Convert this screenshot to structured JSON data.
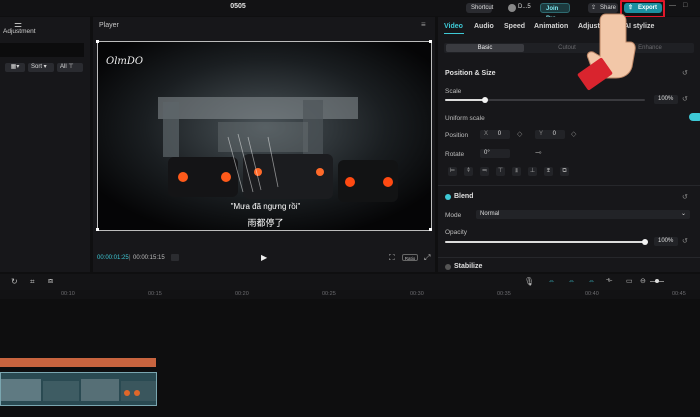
{
  "app": {
    "project_title": "0505"
  },
  "titlebar": {
    "shortcut_label": "Shortcut",
    "user_label": "D...5",
    "join_pro_label": "Join Pro",
    "share_label": "Share",
    "export_label": "Export"
  },
  "left_panel": {
    "adjustment_label": "Adjustment",
    "sort_label": "Sort",
    "all_label": "All"
  },
  "player": {
    "title": "Player",
    "watermark": "OlmDO",
    "subtitle_vi": "\"Mưa đã ngưng rồi\"",
    "subtitle_cn": "雨都停了",
    "time_current": "00:00:01:25",
    "time_total": "00:00:15:15",
    "ratio_label": "Ratio"
  },
  "inspector": {
    "tabs": [
      "Video",
      "Audio",
      "Speed",
      "Animation",
      "Adjustment",
      "AI stylize"
    ],
    "subtabs": [
      "Basic",
      "Cutout",
      "Enhance"
    ],
    "position_size": {
      "title": "Position & Size",
      "scale_label": "Scale",
      "scale_value": "100%",
      "scale_fraction": 0.2,
      "uniform_scale_label": "Uniform scale",
      "position_label": "Position",
      "x_label": "X",
      "x_value": "0",
      "y_label": "Y",
      "y_value": "0",
      "rotate_label": "Rotate",
      "rotate_value": "0°"
    },
    "blend": {
      "title": "Blend",
      "mode_label": "Mode",
      "mode_value": "Normal",
      "opacity_label": "Opacity",
      "opacity_value": "100%",
      "opacity_fraction": 1.0
    },
    "stabilize": {
      "title": "Stabilize"
    }
  },
  "timeline": {
    "ticks": [
      "00:10",
      "00:15",
      "00:20",
      "00:25",
      "00:30",
      "00:35",
      "00:40",
      "00:45"
    ]
  },
  "colors": {
    "accent": "#1b8fa0",
    "highlight": "#e0172a",
    "audio_clip": "#c8643f",
    "cyan_icon": "#3ec9d6"
  }
}
